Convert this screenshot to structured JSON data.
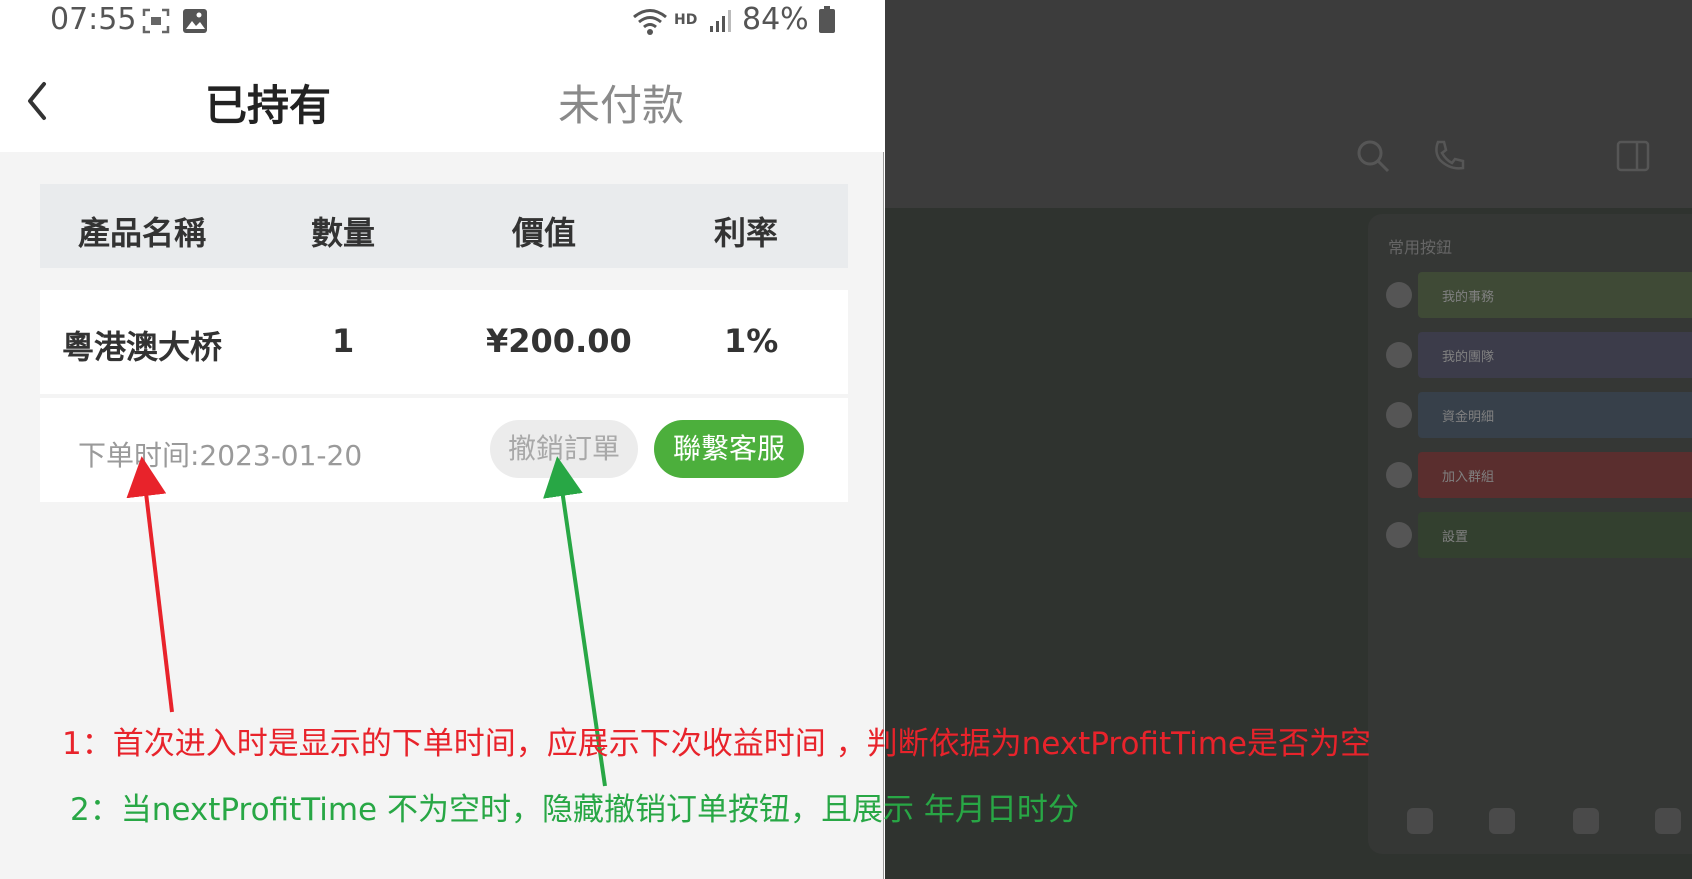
{
  "status_bar": {
    "time": "07:55",
    "network": "HD",
    "battery": "84%"
  },
  "nav": {
    "tab_held": "已持有",
    "tab_unpaid": "未付款"
  },
  "table": {
    "headers": [
      "產品名稱",
      "數量",
      "價值",
      "利率"
    ],
    "row": {
      "name": "粵港澳大桥",
      "qty": "1",
      "value": "¥200.00",
      "rate": "1%"
    }
  },
  "order": {
    "time_label": "下单时间:2023-01-20",
    "cancel_label": "撤銷訂單",
    "contact_label": "聯繫客服"
  },
  "background_panel": {
    "title": "常用按鈕",
    "items": [
      "我的事務",
      "我的團隊",
      "資金明細",
      "加入群組",
      "設置"
    ],
    "item_colors": [
      "#3f4a36",
      "#3c3c4a",
      "#37404a",
      "#5a2e2e",
      "#33402f"
    ]
  },
  "annotations": {
    "note_1": "1：首次进入时是显示的下单时间，应展示下次收益时间 ，判断依据为nextProfitTime是否为空",
    "note_2": "2：当nextProfitTime 不为空时，隐藏撤销订单按钮，且展示 年月日时分",
    "note_1_color": "#e8232b",
    "note_2_color": "#28a745"
  }
}
